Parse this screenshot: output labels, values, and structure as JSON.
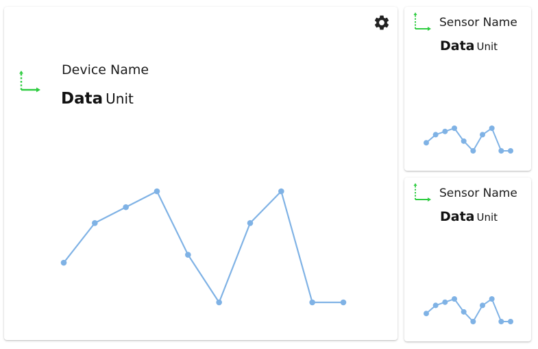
{
  "colors": {
    "accent_green": "#2ecc40",
    "line_blue": "#7fb2e5",
    "icon_dark": "#222222"
  },
  "icons": {
    "axis": "axis-icon",
    "settings": "gear-icon"
  },
  "device": {
    "name": "Device Name",
    "value": "Data",
    "unit": "Unit"
  },
  "sensors": [
    {
      "name": "Sensor Name",
      "value": "Data",
      "unit": "Unit"
    },
    {
      "name": "Sensor Name",
      "value": "Data",
      "unit": "Unit"
    }
  ],
  "chart_data": {
    "type": "line",
    "series": [
      {
        "values": [
          2.5,
          5,
          6,
          7,
          3,
          0,
          5,
          7,
          0,
          0
        ]
      }
    ],
    "grid": false
  }
}
